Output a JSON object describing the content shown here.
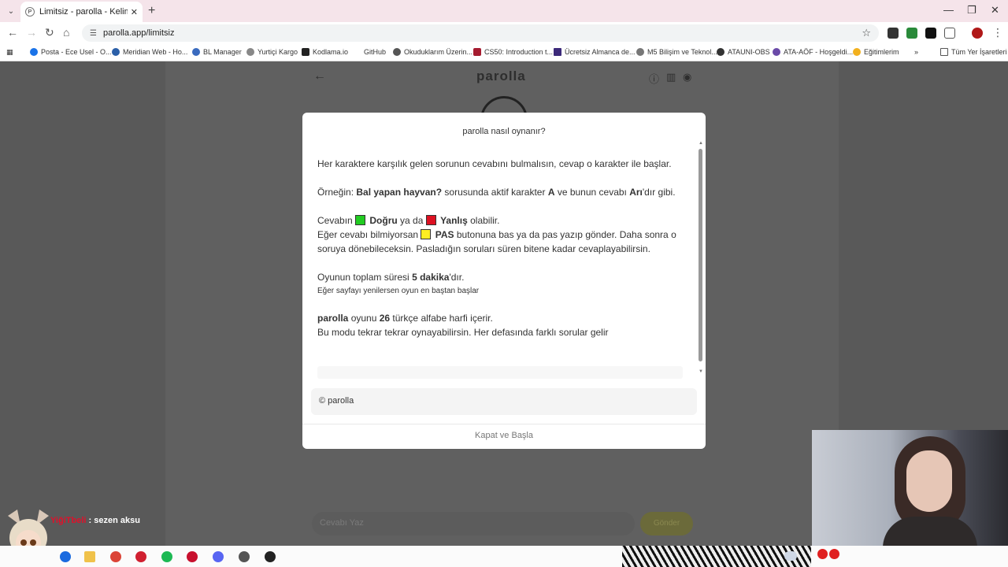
{
  "browser": {
    "tab_title": "Limitsiz - parolla - Kelime oyunu",
    "url": "parolla.app/limitsiz",
    "bookmarks": [
      "Posta - Ece Usel - O...",
      "Meridian Web - Ho...",
      "BL Manager",
      "Yurtiçi Kargo",
      "Kodlama.io",
      "GitHub",
      "Okuduklarım Üzerin...",
      "CS50: Introduction t...",
      "Ücretsiz Almanca de...",
      "M5 Bilişim ve Teknol...",
      "ATAUNI-OBS",
      "ATA-AÖF - Hoşgeldi...",
      "Eğitimlerim",
      "Tüm Yer İşaretleri"
    ]
  },
  "page": {
    "brand": "parolla",
    "answer_placeholder": "Cevabı Yaz",
    "send_label": "Gönder"
  },
  "modal": {
    "title": "parolla nasıl oynanır?",
    "p1": "Her karaktere karşılık gelen sorunun cevabını bulmalısın, cevap o karakter ile başlar.",
    "p2_prefix": "Örneğin: ",
    "p2_question": "Bal yapan hayvan?",
    "p2_mid": " sorusunda aktif karakter ",
    "p2_letter": "A",
    "p2_mid2": " ve bunun cevabı ",
    "p2_answer": "Arı",
    "p2_suffix": "'dır gibi.",
    "p3_prefix": "Cevabın ",
    "p3_correct": "Doğru",
    "p3_mid": " ya da ",
    "p3_wrong": "Yanlış",
    "p3_suffix": " olabilir.",
    "p4_prefix": "Eğer cevabı bilmiyorsan ",
    "p4_pass": "PAS",
    "p4_suffix": " butonuna bas ya da pas yazıp gönder. Daha sonra o soruya dönebileceksin. Pasladığın soruları süren bitene kadar cevaplayabilirsin.",
    "p5_prefix": "Oyunun toplam süresi ",
    "p5_time": "5 dakika",
    "p5_suffix": "'dır.",
    "p5_note": "Eğer sayfayı yenilersen oyun en baştan başlar",
    "p6_brand": "parolla",
    "p6_mid": " oyunu ",
    "p6_count": "26",
    "p6_suffix": " türkçe alfabe harfi içerir.",
    "p6_line2": "Bu modu tekrar tekrar oynayabilirsin. Her defasında farklı sorular gelir",
    "copyright": "© parolla",
    "close_label": "Kapat ve Başla"
  },
  "stream": {
    "chat_user": "YiğiTbeli",
    "chat_message": " : sezen aksu"
  },
  "colors": {
    "correct": "#22cc22",
    "wrong": "#dd1122",
    "pass": "#ffee22"
  }
}
